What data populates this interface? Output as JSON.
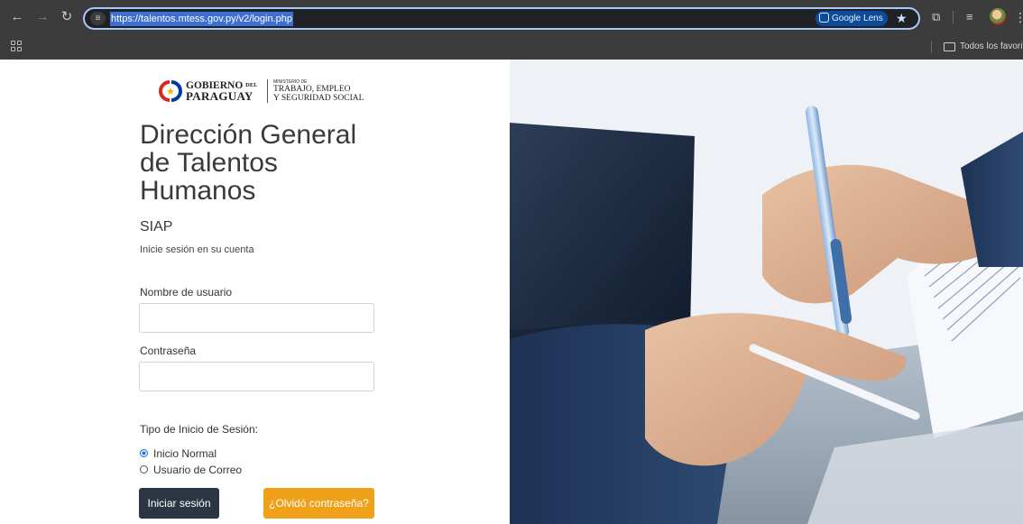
{
  "browser": {
    "url": "https://talentos.mtess.gov.py/v2/login.php",
    "lens_label": "Google Lens",
    "bookmarks_folder": "Todos los favoritos"
  },
  "logo": {
    "gov_line1": "GOBIERNO",
    "gov_line1_small": "DEL",
    "gov_line2": "PARAGUAY",
    "ministry_line1": "MINISTERIO DE",
    "ministry_line2": "TRABAJO, EMPLEO",
    "ministry_line3": "Y SEGURIDAD SOCIAL"
  },
  "login": {
    "title": "Dirección General de Talentos Humanos",
    "system": "SIAP",
    "subtitle": "Inicie sesión en su cuenta",
    "username_label": "Nombre de usuario",
    "username_value": "",
    "password_label": "Contraseña",
    "password_value": "",
    "login_type_label": "Tipo de Inicio de Sesión:",
    "login_types": [
      {
        "label": "Inicio Normal",
        "checked": true
      },
      {
        "label": "Usuario de Correo",
        "checked": false
      }
    ],
    "submit_label": "Iniciar sesión",
    "forgot_label": "¿Olvidó contraseña?"
  },
  "colors": {
    "submit_bg": "#2b3645",
    "forgot_bg": "#f0a11a",
    "text": "#3a3a3a"
  },
  "icons": {
    "back": "arrow-left-icon",
    "forward": "arrow-right-icon",
    "reload": "reload-icon",
    "site_info": "tune-icon",
    "bookmark": "star-icon",
    "extensions": "puzzle-icon",
    "reading_list": "reading-list-icon",
    "profile": "avatar",
    "menu": "kebab-menu-icon",
    "apps": "apps-grid-icon",
    "folder": "folder-icon"
  }
}
